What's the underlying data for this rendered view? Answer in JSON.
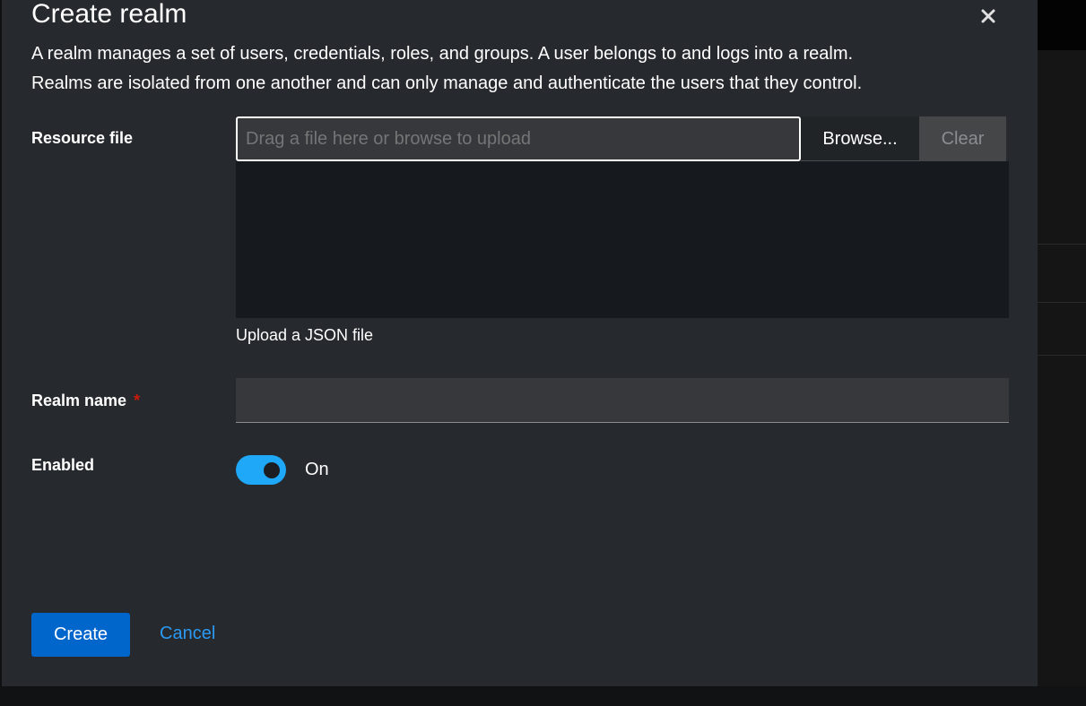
{
  "modal": {
    "title": "Create realm",
    "close_icon": "close-icon",
    "description": [
      "A realm manages a set of users, credentials, roles, and groups. A user belongs to and logs into a realm.",
      "Realms are isolated from one another and can only manage and authenticate the users that they control."
    ]
  },
  "resource_file": {
    "label": "Resource file",
    "placeholder": "Drag a file here or browse to upload",
    "value": "",
    "browse_label": "Browse...",
    "clear_label": "Clear",
    "helper_text": "Upload a JSON file"
  },
  "realm_name": {
    "label": "Realm name",
    "required_marker": "*",
    "value": ""
  },
  "enabled": {
    "label": "Enabled",
    "state_text": "On",
    "checked": true
  },
  "footer": {
    "create_label": "Create",
    "cancel_label": "Cancel"
  },
  "colors": {
    "modal_bg": "#26292d",
    "primary": "#0066cc",
    "link": "#2b9af3",
    "toggle_on": "#1fa7f8",
    "required": "#c9190b"
  }
}
